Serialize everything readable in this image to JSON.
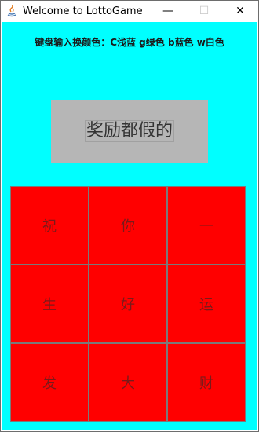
{
  "window": {
    "title": "Welcome to LottoGame",
    "minimize_glyph": "—",
    "maximize_glyph": "☐",
    "close_glyph": "✕"
  },
  "hint": "键盘输入换颜色：C浅蓝 g绿色 b蓝色 w白色",
  "prize_label": "奖励都假的",
  "grid": {
    "cells": [
      "祝",
      "你",
      "一",
      "生",
      "好",
      "运",
      "发",
      "大",
      "财"
    ]
  },
  "colors": {
    "background": "#00ffff",
    "cell": "#ff0000",
    "prize_box": "#b6b6b6"
  }
}
